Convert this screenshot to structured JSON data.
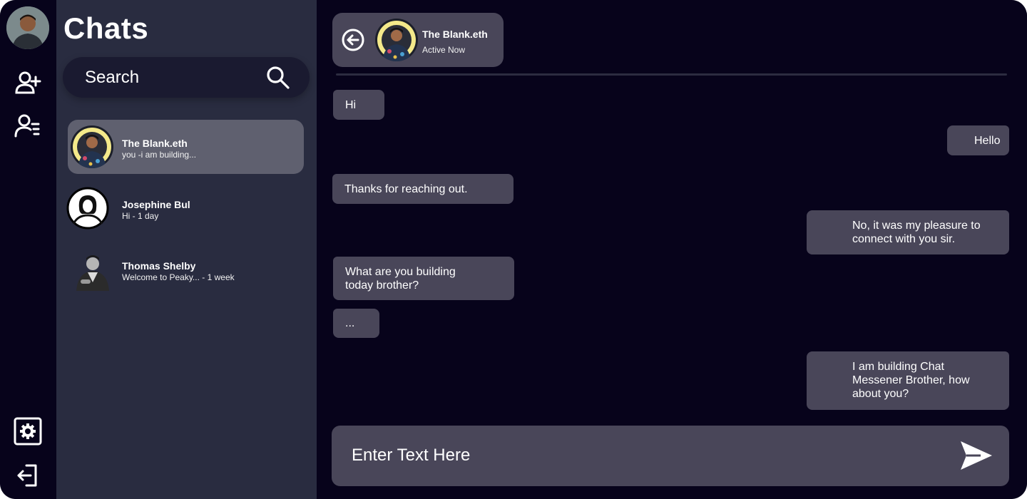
{
  "sidebar": {
    "icons": [
      "profile-avatar",
      "add-user-icon",
      "user-list-icon",
      "settings-icon",
      "logout-icon"
    ]
  },
  "panel": {
    "title": "Chats",
    "search_placeholder": "Search",
    "contacts": [
      {
        "name": "The Blank.eth",
        "preview": "you -i am building...",
        "active": true
      },
      {
        "name": "Josephine Bul",
        "preview": "Hi - 1 day",
        "active": false
      },
      {
        "name": "Thomas Shelby",
        "preview": "Welcome to Peaky... - 1 week",
        "active": false
      }
    ]
  },
  "chat": {
    "header": {
      "name": "The Blank.eth",
      "status": "Active Now"
    },
    "messages": [
      {
        "side": "left",
        "text": "Hi"
      },
      {
        "side": "right",
        "text": "Hello"
      },
      {
        "side": "left",
        "text": "Thanks for reaching out."
      },
      {
        "side": "right",
        "text": "No, it was my pleasure to connect with you sir."
      },
      {
        "side": "left",
        "text": "What are you building today brother?"
      },
      {
        "side": "left",
        "text": "..."
      },
      {
        "side": "right",
        "text": "I am building Chat Messener Brother, how about you?"
      }
    ],
    "composer": {
      "placeholder": "Enter Text Here"
    }
  },
  "colors": {
    "background": "#07031b",
    "panel": "#292c40",
    "bubble": "#494659",
    "active_contact": "#5f606f"
  }
}
